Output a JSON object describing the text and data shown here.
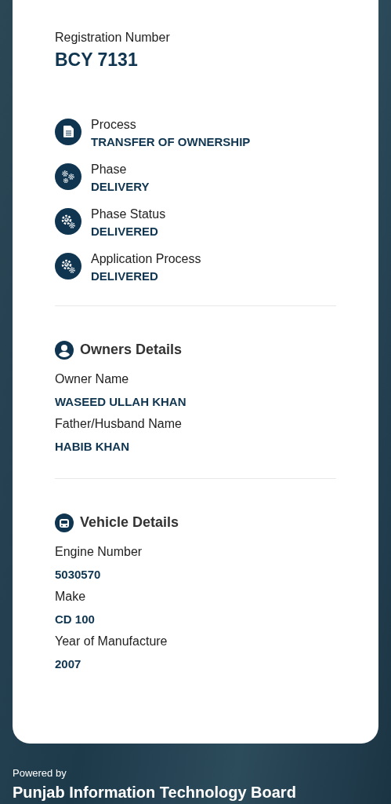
{
  "registration": {
    "label": "Registration Number",
    "value": "BCY 7131"
  },
  "process_items": [
    {
      "kind": "document",
      "label": "Process",
      "value": "TRANSFER OF OWNERSHIP"
    },
    {
      "kind": "gears",
      "label": "Phase",
      "value": "DELIVERY"
    },
    {
      "kind": "gear-check",
      "label": "Phase Status",
      "value": "DELIVERED"
    },
    {
      "kind": "gear-check",
      "label": "Application Process",
      "value": "DELIVERED"
    }
  ],
  "sections": [
    {
      "kind": "person",
      "title": "Owners Details",
      "fields": [
        {
          "label": "Owner Name",
          "value": "WASEED ULLAH KHAN"
        },
        {
          "label": "Father/Husband Name",
          "value": "HABIB KHAN"
        }
      ]
    },
    {
      "kind": "car",
      "title": "Vehicle Details",
      "fields": [
        {
          "label": "Engine Number",
          "value": "5030570"
        },
        {
          "label": "Make",
          "value": "CD 100"
        },
        {
          "label": "Year of Manufacture",
          "value": "2007"
        }
      ]
    }
  ],
  "footer": {
    "caption": "Powered by",
    "organization": "Punjab Information Technology Board"
  }
}
